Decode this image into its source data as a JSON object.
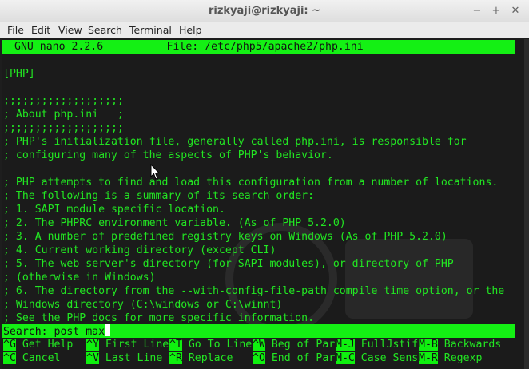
{
  "window": {
    "title": "rizkyaji@rizkyaji: ~",
    "minimize_glyph": "−",
    "maximize_glyph": "+",
    "close_glyph": "✕"
  },
  "menu": {
    "file": "File",
    "edit": "Edit",
    "view": "View",
    "search": "Search",
    "terminal": "Terminal",
    "help": "Help"
  },
  "nano": {
    "header": "GNU nano 2.2.6          File: /etc/php5/apache2/php.ini",
    "lines": [
      "",
      "[PHP]",
      "",
      ";;;;;;;;;;;;;;;;;;;",
      "; About php.ini   ;",
      ";;;;;;;;;;;;;;;;;;;",
      "; PHP's initialization file, generally called php.ini, is responsible for",
      "; configuring many of the aspects of PHP's behavior.",
      "",
      "; PHP attempts to find and load this configuration from a number of locations.",
      "; The following is a summary of its search order:",
      "; 1. SAPI module specific location.",
      "; 2. The PHPRC environment variable. (As of PHP 5.2.0)",
      "; 3. A number of predefined registry keys on Windows (As of PHP 5.2.0)",
      "; 4. Current working directory (except CLI)",
      "; 5. The web server's directory (for SAPI modules), or directory of PHP",
      "; (otherwise in Windows)",
      "; 6. The directory from the --with-config-file-path compile time option, or the",
      "; Windows directory (C:\\windows or C:\\winnt)",
      "; See the PHP docs for more specific information."
    ],
    "search_prompt": "Search: post max",
    "shortcuts_row1": [
      {
        "key": "^G",
        "label": " Get Help  "
      },
      {
        "key": "^Y",
        "label": " First Line"
      },
      {
        "key": "^T",
        "label": " Go To Line"
      },
      {
        "key": "^W",
        "label": " Beg of Par"
      },
      {
        "key": "M-J",
        "label": " FullJstif"
      },
      {
        "key": "M-B",
        "label": " Backwards"
      }
    ],
    "shortcuts_row2": [
      {
        "key": "^C",
        "label": " Cancel    "
      },
      {
        "key": "^V",
        "label": " Last Line "
      },
      {
        "key": "^R",
        "label": " Replace   "
      },
      {
        "key": "^O",
        "label": " End of Par"
      },
      {
        "key": "M-C",
        "label": " Case Sens"
      },
      {
        "key": "M-R",
        "label": " Regexp"
      }
    ]
  }
}
